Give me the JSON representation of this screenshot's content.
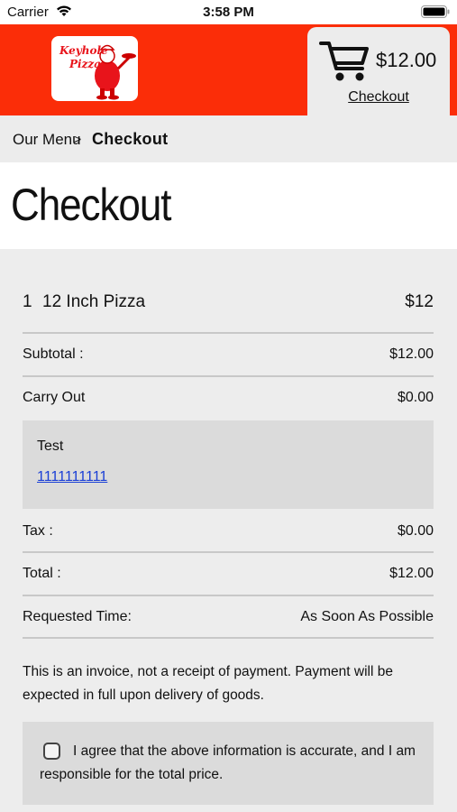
{
  "status_bar": {
    "carrier": "Carrier",
    "time": "3:58 PM"
  },
  "header": {
    "logo_text_line1": "Keyhole",
    "logo_text_line2": "Pizza",
    "cart_total": "$12.00",
    "checkout_link": "Checkout",
    "brand_color": "#fb2d08"
  },
  "breadcrumb": {
    "menu": "Our Menu",
    "separator": ">",
    "current": "Checkout"
  },
  "page_title": "Checkout",
  "order": {
    "item": {
      "quantity": "1",
      "name": "12 Inch Pizza",
      "price": "$12"
    },
    "subtotal_label": "Subtotal :",
    "subtotal_value": "$12.00",
    "fulfillment_label": "Carry Out",
    "fulfillment_value": "$0.00",
    "customer_name": "Test",
    "customer_phone": "1111111111",
    "tax_label": "Tax :",
    "tax_value": "$0.00",
    "total_label": "Total :",
    "total_value": "$12.00",
    "requested_time_label": "Requested Time:",
    "requested_time_value": "As Soon As Possible"
  },
  "invoice_note": "This is an invoice, not a receipt of payment. Payment will be expected in full upon delivery of goods.",
  "agreement": {
    "text": "I agree that the above information is accurate, and I am responsible for the total price.",
    "checked": false
  }
}
